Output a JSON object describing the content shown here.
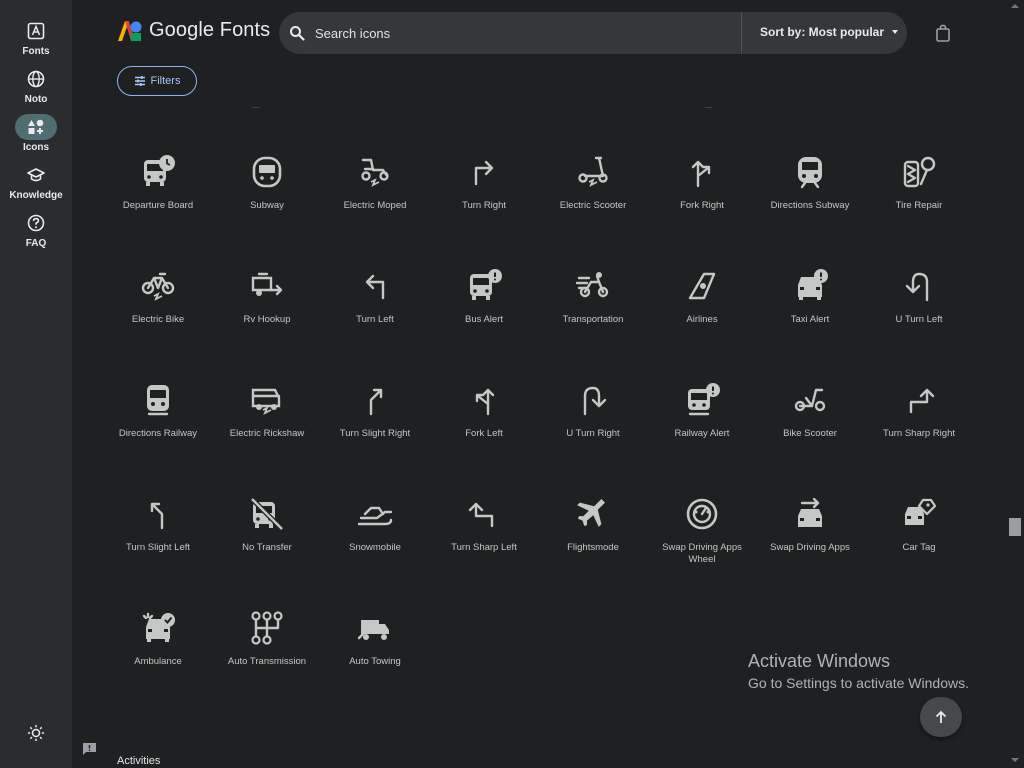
{
  "app": {
    "brand": "Google Fonts"
  },
  "nav": [
    {
      "label": "Fonts",
      "icon": "fonts-icon"
    },
    {
      "label": "Noto",
      "icon": "globe-icon"
    },
    {
      "label": "Icons",
      "icon": "shapes-icon",
      "active": true
    },
    {
      "label": "Knowledge",
      "icon": "graduation-cap-icon"
    },
    {
      "label": "FAQ",
      "icon": "help-icon"
    }
  ],
  "search": {
    "placeholder": "Search icons",
    "value": ""
  },
  "sort": {
    "label": "Sort by: Most popular"
  },
  "filters": {
    "label": "Filters"
  },
  "icons": [
    {
      "name": "Departure Board",
      "icon": "departure-board-icon"
    },
    {
      "name": "Subway",
      "icon": "subway-icon"
    },
    {
      "name": "Electric Moped",
      "icon": "electric-moped-icon"
    },
    {
      "name": "Turn Right",
      "icon": "turn-right-icon"
    },
    {
      "name": "Electric Scooter",
      "icon": "electric-scooter-icon"
    },
    {
      "name": "Fork Right",
      "icon": "fork-right-icon"
    },
    {
      "name": "Directions Subway",
      "icon": "directions-subway-icon"
    },
    {
      "name": "Tire Repair",
      "icon": "tire-repair-icon"
    },
    {
      "name": "Electric Bike",
      "icon": "electric-bike-icon"
    },
    {
      "name": "Rv Hookup",
      "icon": "rv-hookup-icon"
    },
    {
      "name": "Turn Left",
      "icon": "turn-left-icon"
    },
    {
      "name": "Bus Alert",
      "icon": "bus-alert-icon"
    },
    {
      "name": "Transportation",
      "icon": "transportation-icon"
    },
    {
      "name": "Airlines",
      "icon": "airlines-icon"
    },
    {
      "name": "Taxi Alert",
      "icon": "taxi-alert-icon"
    },
    {
      "name": "U Turn Left",
      "icon": "u-turn-left-icon"
    },
    {
      "name": "Directions Railway",
      "icon": "directions-railway-icon"
    },
    {
      "name": "Electric Rickshaw",
      "icon": "electric-rickshaw-icon"
    },
    {
      "name": "Turn Slight Right",
      "icon": "turn-slight-right-icon"
    },
    {
      "name": "Fork Left",
      "icon": "fork-left-icon"
    },
    {
      "name": "U Turn Right",
      "icon": "u-turn-right-icon"
    },
    {
      "name": "Railway Alert",
      "icon": "railway-alert-icon"
    },
    {
      "name": "Bike Scooter",
      "icon": "bike-scooter-icon"
    },
    {
      "name": "Turn Sharp Right",
      "icon": "turn-sharp-right-icon"
    },
    {
      "name": "Turn Slight Left",
      "icon": "turn-slight-left-icon"
    },
    {
      "name": "No Transfer",
      "icon": "no-transfer-icon"
    },
    {
      "name": "Snowmobile",
      "icon": "snowmobile-icon"
    },
    {
      "name": "Turn Sharp Left",
      "icon": "turn-sharp-left-icon"
    },
    {
      "name": "Flightsmode",
      "icon": "flightsmode-icon"
    },
    {
      "name": "Swap Driving Apps Wheel",
      "icon": "swap-driving-apps-wheel-icon"
    },
    {
      "name": "Swap Driving Apps",
      "icon": "swap-driving-apps-icon"
    },
    {
      "name": "Car Tag",
      "icon": "car-tag-icon"
    },
    {
      "name": "Ambulance",
      "icon": "ambulance-icon"
    },
    {
      "name": "Auto Transmission",
      "icon": "auto-transmission-icon"
    },
    {
      "name": "Auto Towing",
      "icon": "auto-towing-icon"
    }
  ],
  "next_section": "Activities",
  "watermark": {
    "title": "Activate Windows",
    "subtitle": "Go to Settings to activate Windows."
  },
  "colors": {
    "background": "#1f2022",
    "rail": "#2a2c2f",
    "active_pill": "#4e6e72",
    "accent": "#a8c7fa",
    "icon": "#c4c7c5"
  }
}
